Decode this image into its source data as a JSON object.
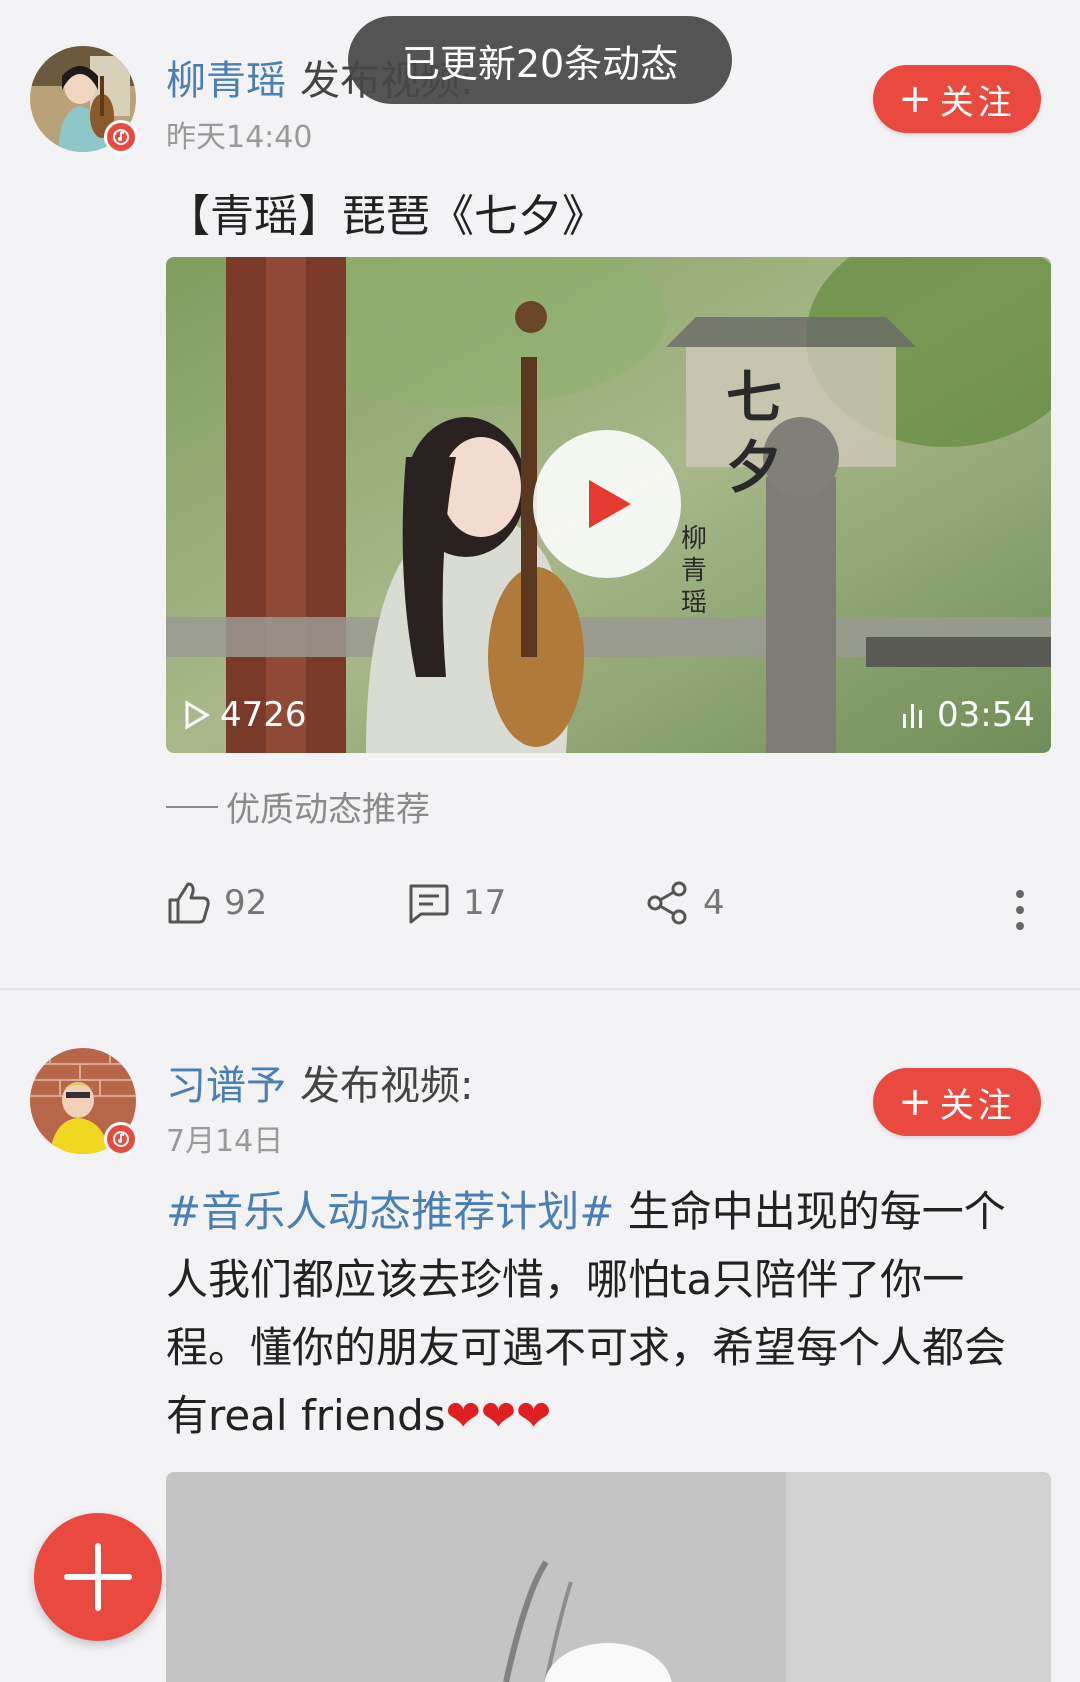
{
  "toast": {
    "text": "已更新20条动态"
  },
  "posts": [
    {
      "author": "柳青瑶",
      "action": "发布视频:",
      "time": "昨天14:40",
      "follow_label": "关注",
      "title": "【青瑶】琵琶《七夕》",
      "video": {
        "overlay_title": "七夕",
        "overlay_artist": "柳青瑶",
        "views": "4726",
        "duration": "03:54"
      },
      "recommend_label": "优质动态推荐",
      "likes": "92",
      "comments": "17",
      "shares": "4"
    },
    {
      "author": "习谱予",
      "action": "发布视频:",
      "time": "7月14日",
      "follow_label": "关注",
      "hashtag": "#音乐人动态推荐计划#",
      "text": " 生命中出现的每一个人我们都应该去珍惜，哪怕ta只陪伴了你一程。懂你的朋友可遇不可求，希望每个人都会有real friends",
      "hearts": "❤❤❤"
    }
  ],
  "colors": {
    "accent": "#e9493f",
    "link": "#4a7fb5",
    "background": "#f3f3f5"
  },
  "icons": [
    "music-note-icon",
    "plus-icon",
    "play-icon",
    "view-count-icon",
    "audio-bars-icon",
    "like-icon",
    "comment-icon",
    "share-icon",
    "more-icon",
    "fab-plus-icon"
  ]
}
